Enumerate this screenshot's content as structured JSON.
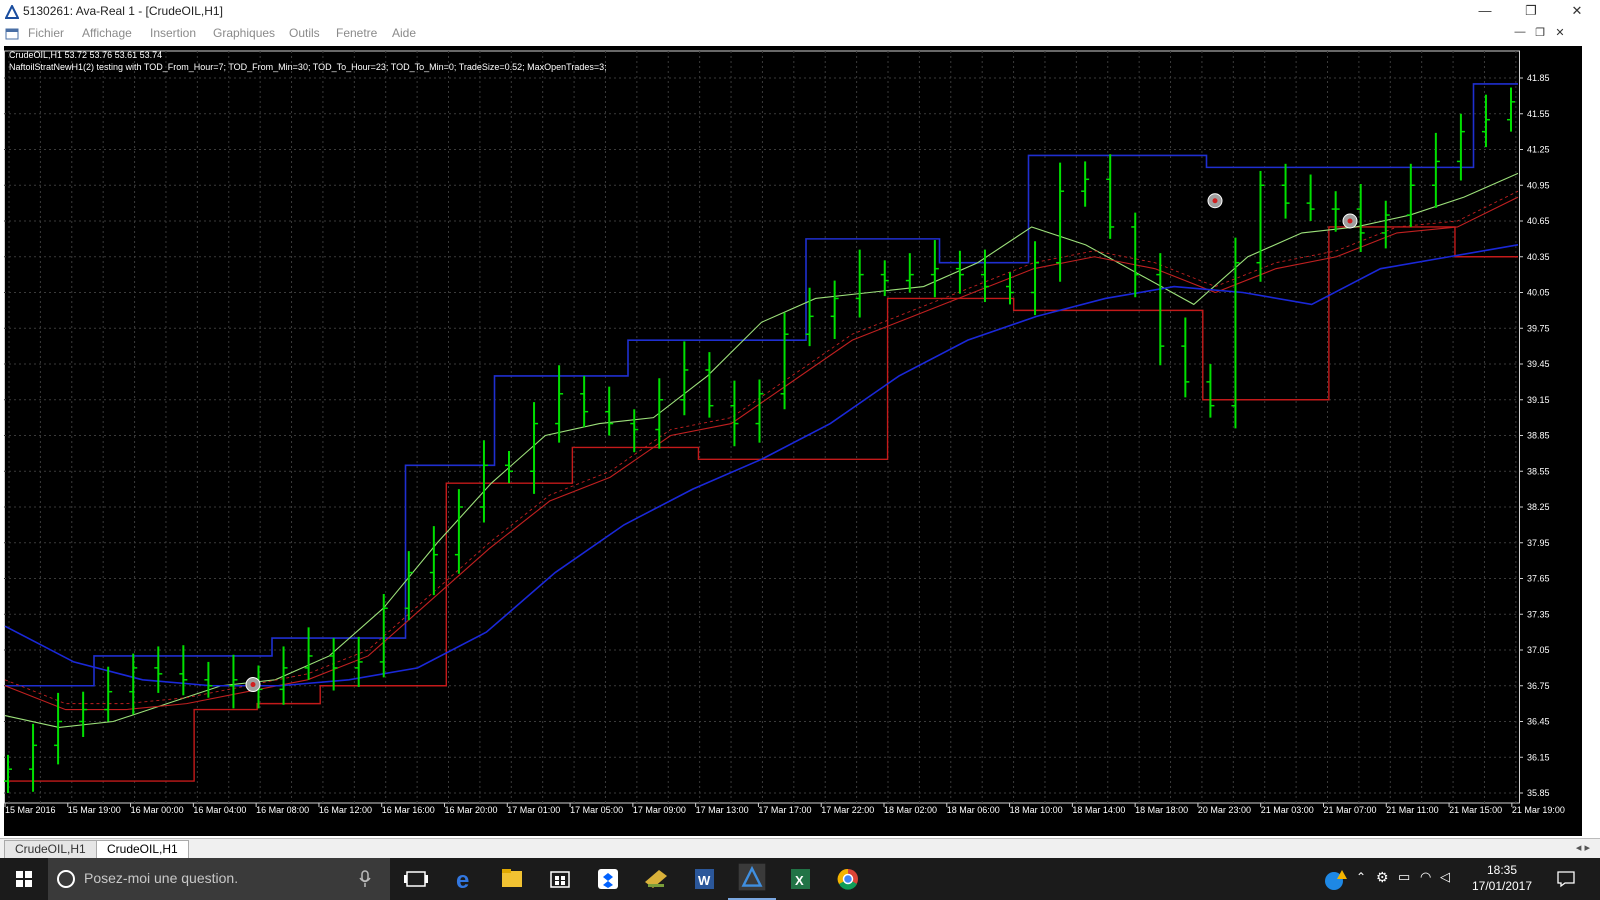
{
  "window": {
    "title": "5130261: Ava-Real 1 - [CrudeOIL,H1]",
    "minimize_glyph": "—",
    "restore_glyph": "❐",
    "close_glyph": "✕"
  },
  "menu": {
    "items": [
      "Fichier",
      "Affichage",
      "Insertion",
      "Graphiques",
      "Outils",
      "Fenetre",
      "Aide"
    ]
  },
  "chart_header": {
    "symbol_line": "CrudeOIL,H1  53.72 53.76 53.61 53.74",
    "ea_line": "NaftoilStratNewH1(2) testing with TOD_From_Hour=7; TOD_From_Min=30; TOD_To_Hour=23; TOD_To_Min=0; TradeSize=0.52; MaxOpenTrades=3;"
  },
  "tabs": [
    {
      "label": "CrudeOIL,H1",
      "active": false
    },
    {
      "label": "CrudeOIL,H1",
      "active": true
    }
  ],
  "taskbar": {
    "search_placeholder": "Posez-moi une question.",
    "time": "18:35",
    "date": "17/01/2017"
  },
  "chart_data": {
    "type": "candlestick",
    "symbol": "CrudeOIL",
    "timeframe": "H1",
    "y_ticks": [
      41.85,
      41.55,
      41.25,
      40.95,
      40.65,
      40.35,
      40.05,
      39.75,
      39.45,
      39.15,
      38.85,
      38.55,
      38.25,
      37.95,
      37.65,
      37.35,
      37.05,
      36.75,
      36.45,
      36.15,
      35.85
    ],
    "ylim": [
      35.85,
      41.85
    ],
    "x_ticks": [
      "15 Mar 2016",
      "15 Mar 19:00",
      "16 Mar 00:00",
      "16 Mar 04:00",
      "16 Mar 08:00",
      "16 Mar 12:00",
      "16 Mar 16:00",
      "16 Mar 20:00",
      "17 Mar 01:00",
      "17 Mar 05:00",
      "17 Mar 09:00",
      "17 Mar 13:00",
      "17 Mar 17:00",
      "17 Mar 22:00",
      "18 Mar 02:00",
      "18 Mar 06:00",
      "18 Mar 10:00",
      "18 Mar 14:00",
      "18 Mar 18:00",
      "20 Mar 23:00",
      "21 Mar 03:00",
      "21 Mar 07:00",
      "21 Mar 11:00",
      "21 Mar 15:00",
      "21 Mar 19:00"
    ],
    "grid": true,
    "colors": {
      "background": "#000000",
      "grid": "#3a3a3a",
      "bars": "#00e000",
      "channel_blue": "#1f2fd0",
      "channel_red": "#c41a1a",
      "ma_green": "#9ce07a",
      "ma_red": "#c02020",
      "ma_blue": "#1a28d8"
    },
    "series": [
      {
        "values": [
          36.05,
          36.25,
          36.45,
          36.55,
          36.7,
          36.9,
          36.85,
          36.8,
          36.75,
          36.8,
          36.72,
          36.9,
          37.0,
          36.9,
          36.95,
          37.4,
          37.7,
          37.85,
          38.25,
          38.6,
          38.55,
          38.95,
          39.2,
          39.05,
          38.95,
          38.9,
          39.15,
          39.4,
          39.1,
          38.95,
          39.2,
          39.7,
          39.85,
          40.0,
          40.2,
          40.15,
          40.2,
          40.25,
          40.2,
          40.1,
          40.05,
          40.3,
          40.9,
          41.0,
          40.6,
          40.2,
          39.6,
          39.3,
          39.1,
          40.3,
          40.95,
          40.8,
          40.75,
          40.75,
          40.55,
          40.7,
          40.95,
          41.15,
          41.4,
          41.5,
          41.65
        ]
      },
      {
        "values": [
          36.75,
          36.75,
          37.0,
          37.0,
          37.0,
          37.0,
          37.15,
          37.15,
          37.15,
          38.6,
          38.6,
          39.35,
          39.35,
          39.35,
          39.65,
          39.65,
          39.65,
          39.65,
          40.5,
          40.5,
          40.5,
          40.3,
          40.3,
          41.2,
          41.2,
          41.2,
          41.2,
          41.1,
          41.1,
          41.1,
          41.1,
          41.1,
          41.1,
          41.8,
          41.8
        ]
      },
      {
        "values": [
          35.95,
          35.95,
          35.95,
          36.55,
          36.6,
          36.75,
          36.75,
          38.45,
          38.45,
          38.75,
          38.75,
          38.65,
          38.65,
          38.65,
          40.0,
          40.0,
          39.9,
          39.9,
          39.9,
          39.15,
          39.15,
          40.6,
          40.6,
          40.35,
          40.35
        ]
      },
      {
        "values": [
          36.5,
          36.4,
          36.45,
          36.6,
          36.75,
          36.8,
          37.0,
          37.4,
          37.95,
          38.45,
          38.85,
          38.95,
          39.0,
          39.35,
          39.8,
          40.0,
          40.05,
          40.1,
          40.3,
          40.6,
          40.45,
          40.2,
          39.95,
          40.35,
          40.55,
          40.6,
          40.7,
          40.85,
          41.05
        ]
      },
      {
        "values": [
          36.75,
          36.55,
          36.55,
          36.6,
          36.7,
          36.8,
          37.0,
          37.45,
          37.9,
          38.3,
          38.5,
          38.85,
          38.95,
          39.3,
          39.65,
          39.85,
          40.05,
          40.25,
          40.35,
          40.25,
          40.05,
          40.25,
          40.35,
          40.55,
          40.6,
          40.85
        ]
      },
      {
        "values": [
          37.25,
          36.95,
          36.8,
          36.75,
          36.75,
          36.8,
          36.9,
          37.2,
          37.7,
          38.1,
          38.4,
          38.65,
          38.95,
          39.35,
          39.65,
          39.85,
          40.0,
          40.1,
          40.05,
          39.95,
          40.25,
          40.35,
          40.45
        ]
      }
    ],
    "trade_markers": [
      {
        "time": "16 Mar 07:00",
        "price": 36.76
      },
      {
        "time": "20 Mar 23:00",
        "price": 40.82
      },
      {
        "time": "21 Mar 06:00",
        "price": 40.65
      }
    ]
  }
}
